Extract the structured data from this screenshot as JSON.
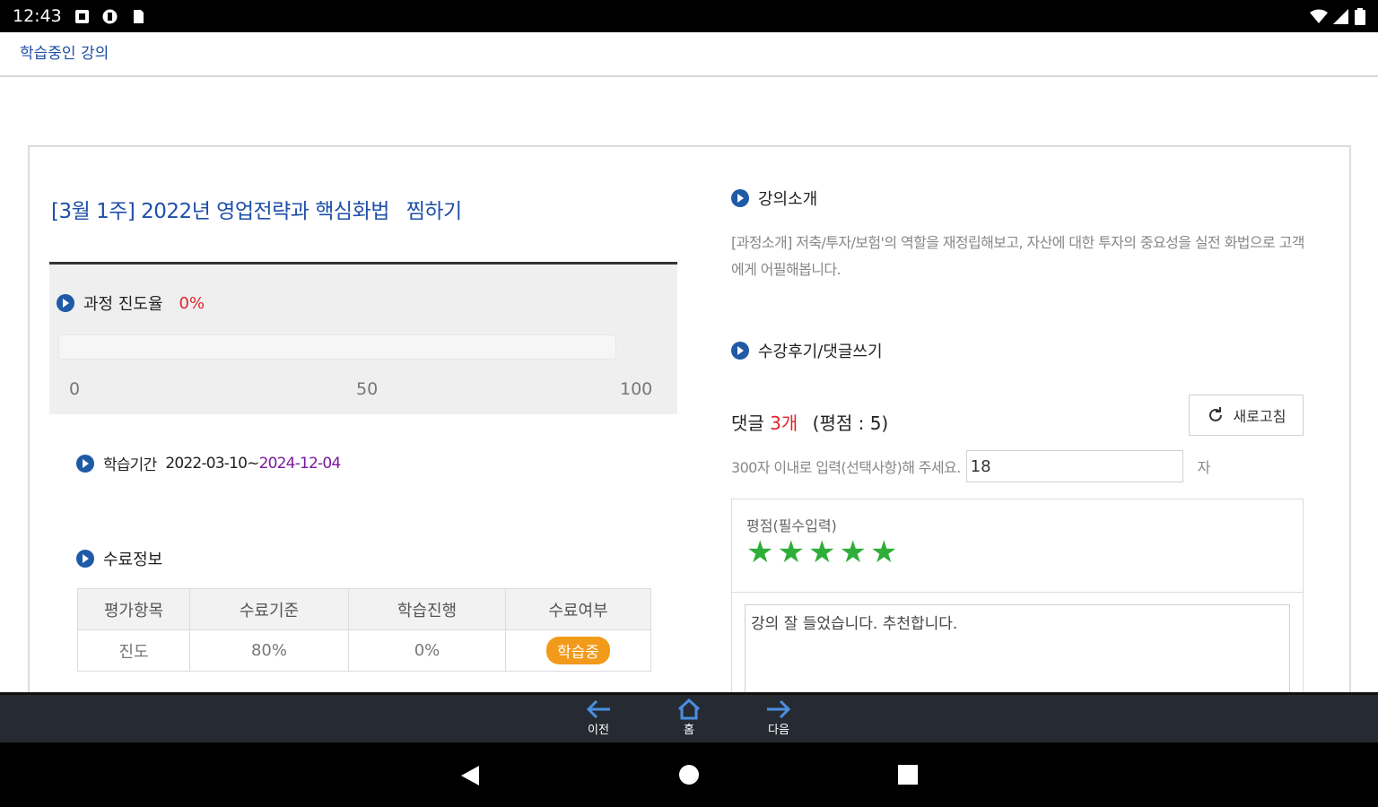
{
  "status_bar": {
    "time": "12:43"
  },
  "breadcrumb": "학습중인 강의",
  "course": {
    "title": "[3월 1주] 2022년 영업전략과 핵심화법",
    "wishlist_label": "찜하기",
    "progress": {
      "label": "과정 진도율",
      "value_text": "0%",
      "value": 0,
      "ticks": [
        "0",
        "50",
        "100"
      ]
    },
    "period": {
      "label": "학습기간",
      "start": "2022-03-10",
      "separator": "~",
      "end": "2024-12-04"
    },
    "completion": {
      "label": "수료정보",
      "headers": [
        "평가항목",
        "수료기준",
        "학습진행",
        "수료여부"
      ],
      "row": {
        "item": "진도",
        "criteria": "80%",
        "progress": "0%",
        "status": "학습중"
      }
    }
  },
  "intro": {
    "label": "강의소개",
    "text": "[과정소개] 저축/투자/보험'의 역할을 재정립해보고, 자산에 대한 투자의 중요성을 실전 화법으로 고객에게 어필해봅니다."
  },
  "reviews": {
    "label": "수강후기/댓글쓰기",
    "count_prefix": "댓글",
    "count": "3개",
    "rating_summary": "(평점 : 5)",
    "refresh_label": "새로고침",
    "limit_text": "300자 이내로 입력(선택사항)해 주세요.",
    "char_count": "18",
    "char_unit": "자",
    "rating_label": "평점(필수입력)",
    "rating": 5,
    "comment": "강의 잘 들었습니다. 추천합니다."
  },
  "bottom_nav": {
    "prev": "이전",
    "home": "홈",
    "next": "다음"
  },
  "colors": {
    "accent": "#1f4fa8",
    "highlight": "#e0242b",
    "star": "#2fae3a",
    "badge": "#f29a1a"
  }
}
